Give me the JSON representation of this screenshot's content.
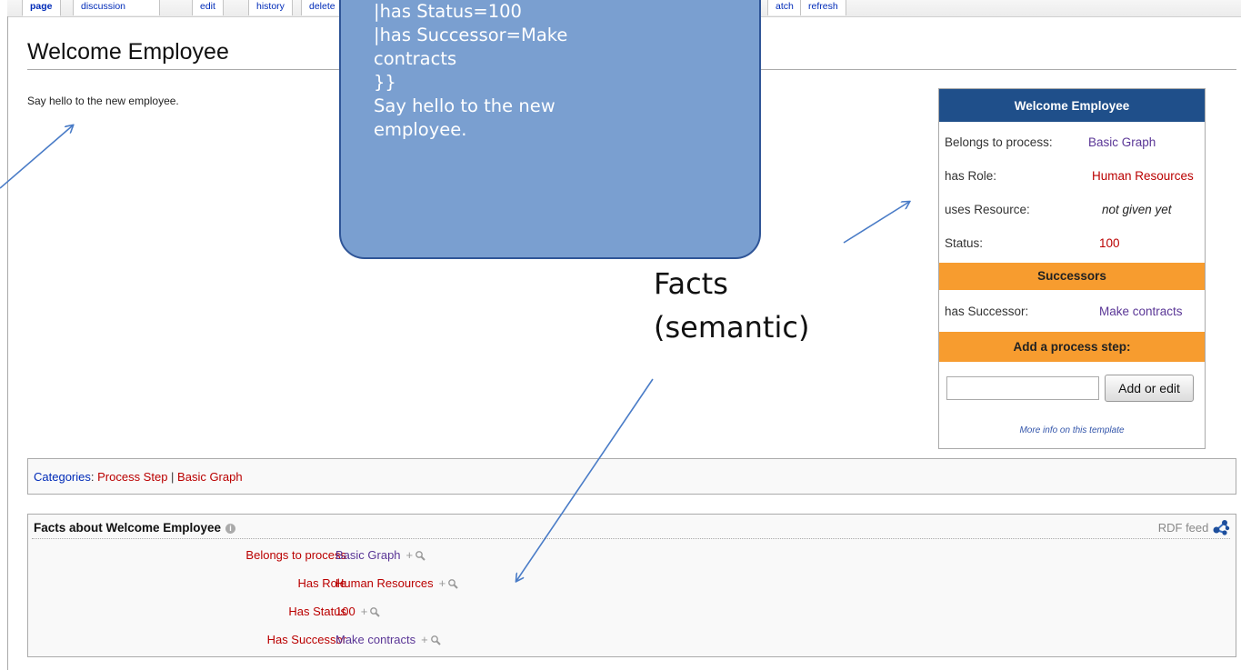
{
  "tabs": {
    "page": "page",
    "discussion": "discussion",
    "edit": "edit",
    "history": "history",
    "delete": "delete",
    "watch": "atch",
    "refresh": "refresh"
  },
  "page": {
    "title": "Welcome Employee",
    "intro": "Say hello to the new employee."
  },
  "callout": {
    "lines": [
      "|has Status=100",
      "|has Successor=Make",
      "contracts",
      "}}",
      "Say hello to the new",
      "employee."
    ]
  },
  "annotation": {
    "line1": "Facts",
    "line2": "(semantic)"
  },
  "infobox": {
    "title": "Welcome Employee",
    "rows": [
      {
        "key": "Belongs to process:",
        "value": "Basic Graph"
      },
      {
        "key": "has Role:",
        "value": "Human Resources"
      },
      {
        "key": "uses Resource:",
        "value": "not given yet"
      },
      {
        "key": "Status:",
        "value": "100"
      }
    ],
    "successors_header": "Successors",
    "successor": {
      "key": "has Successor:",
      "value": "Make contracts"
    },
    "add_step_header": "Add a process step:",
    "add_step_input_value": "",
    "add_button": "Add or edit",
    "more_info": "More info on this template"
  },
  "categories": {
    "label": "Categories",
    "items": [
      "Process Step",
      "Basic Graph"
    ]
  },
  "factbox": {
    "title": "Facts about Welcome Employee",
    "rdf_label": "RDF feed",
    "rows": [
      {
        "property": "Belongs to process",
        "value": "Basic Graph",
        "plus": "+"
      },
      {
        "property": "Has Role",
        "value": "Human Resources",
        "plus": "+"
      },
      {
        "property": "Has Status",
        "value": "100",
        "plus": "+"
      },
      {
        "property": "Has Successor",
        "value": "Make contracts",
        "plus": "+"
      }
    ]
  },
  "colors": {
    "infobox_header": "#1f4f8a",
    "infobox_band": "#f79c2f",
    "callout_fill": "#7a9fd0",
    "callout_border": "#2f5597",
    "link_red": "#ba0000",
    "link_purple": "#5a3696",
    "arrow": "#4a7cc7"
  }
}
